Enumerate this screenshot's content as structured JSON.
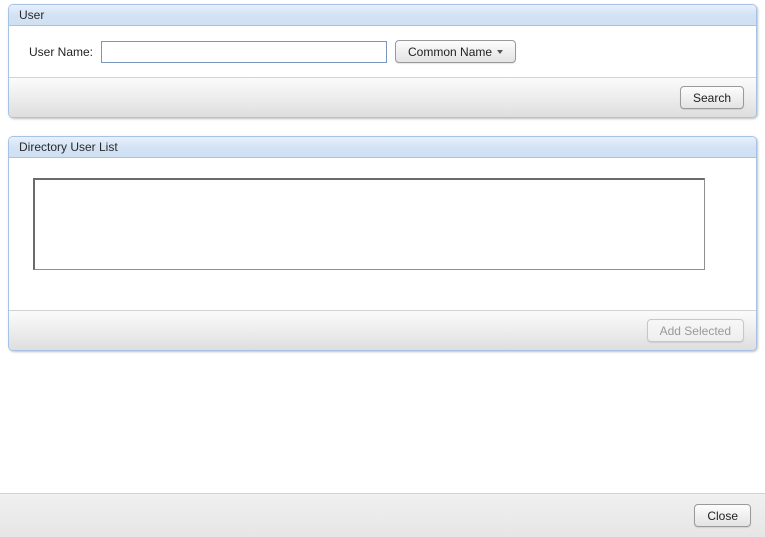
{
  "user_panel": {
    "title": "User",
    "username_label": "User Name:",
    "username_value": "",
    "search_type": "Common Name",
    "search_button": "Search"
  },
  "directory_panel": {
    "title": "Directory User List",
    "add_selected_button": "Add Selected"
  },
  "footer": {
    "close_button": "Close"
  }
}
